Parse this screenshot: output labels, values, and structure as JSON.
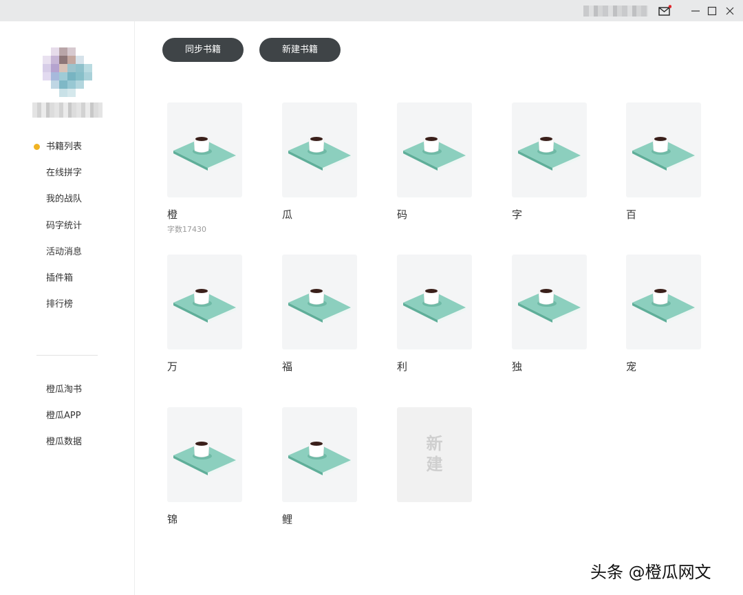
{
  "titlebar": {
    "icons": [
      "mail-icon",
      "minimize-icon",
      "maximize-icon",
      "close-icon"
    ],
    "notification_color": "#e0252b"
  },
  "sidebar": {
    "active_color": "#f0b323",
    "items": [
      {
        "label": "书籍列表",
        "active": true
      },
      {
        "label": "在线拼字"
      },
      {
        "label": "我的战队"
      },
      {
        "label": "码字统计"
      },
      {
        "label": "活动消息"
      },
      {
        "label": "插件箱"
      },
      {
        "label": "排行榜"
      }
    ],
    "secondary": [
      {
        "label": "橙瓜淘书"
      },
      {
        "label": "橙瓜APP"
      },
      {
        "label": "橙瓜数据"
      }
    ]
  },
  "toolbar": {
    "sync_label": "同步书籍",
    "new_label": "新建书籍"
  },
  "books": [
    {
      "title": "橙",
      "count": "字数17430"
    },
    {
      "title": "瓜"
    },
    {
      "title": "码"
    },
    {
      "title": "字"
    },
    {
      "title": "百"
    },
    {
      "title": "万"
    },
    {
      "title": "福"
    },
    {
      "title": "利"
    },
    {
      "title": "独"
    },
    {
      "title": "宠"
    },
    {
      "title": "锦"
    },
    {
      "title": "鲤"
    }
  ],
  "new_book": {
    "line1": "新",
    "line2": "建"
  },
  "watermark": "头条 @橙瓜网文",
  "colors": {
    "button_bg": "#3f4447",
    "book_green": "#7fc8b4",
    "cup_coffee": "#3a1f1a"
  }
}
